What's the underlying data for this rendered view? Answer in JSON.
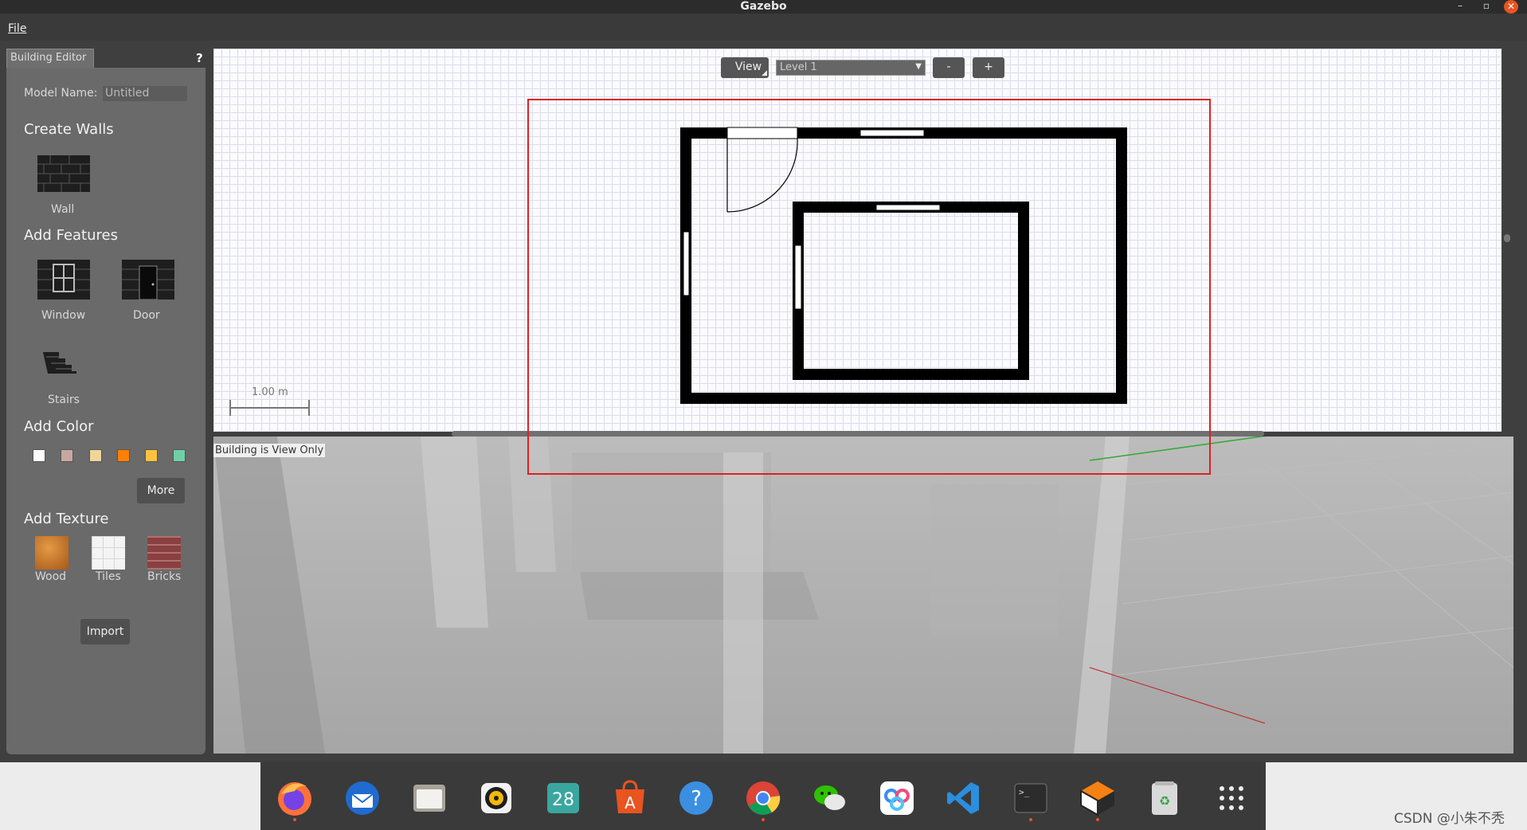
{
  "window": {
    "title": "Gazebo"
  },
  "menu": {
    "file": "File"
  },
  "panel": {
    "tab_label": "Building Editor",
    "help": "?",
    "model_name_label": "Model Name:",
    "model_name_value": "Untitled",
    "create_walls": "Create Walls",
    "wall_label": "Wall",
    "add_features": "Add Features",
    "window_label": "Window",
    "door_label": "Door",
    "stairs_label": "Stairs",
    "add_color": "Add Color",
    "colors": [
      "#ffffff",
      "#c8a7a0",
      "#f0d49a",
      "#ff7f00",
      "#ffc240",
      "#6fd0a8"
    ],
    "more": "More",
    "add_texture": "Add Texture",
    "wood": "Wood",
    "tiles": "Tiles",
    "bricks": "Bricks",
    "import": "Import"
  },
  "editor": {
    "view_button": "View",
    "level_value": "Level 1",
    "minus": "-",
    "plus": "+",
    "scale_label": "1.00 m",
    "view_only_notice": "Building is View Only"
  },
  "dock": {
    "apps": [
      "firefox-icon",
      "thunderbird-icon",
      "files-icon",
      "rhythmbox-icon",
      "calendar-icon",
      "software-center-icon",
      "help-icon",
      "chrome-icon",
      "wechat-icon",
      "baidu-netdisk-icon",
      "vscode-icon",
      "terminal-icon",
      "gazebo-icon",
      "trash-icon",
      "app-grid-icon"
    ],
    "calendar_day": "28"
  },
  "watermark": "CSDN @小朱不秃"
}
